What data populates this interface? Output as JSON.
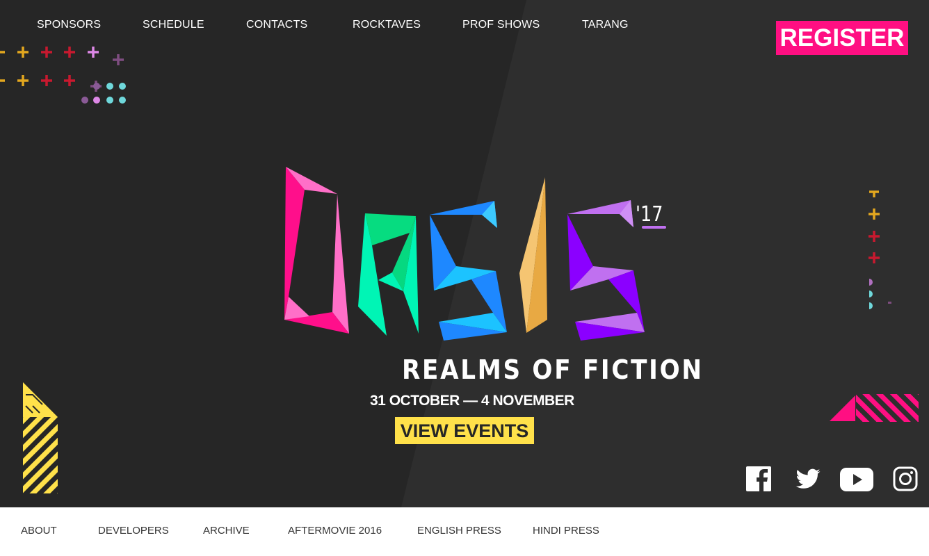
{
  "nav": {
    "items": [
      "SPONSORS",
      "SCHEDULE",
      "CONTACTS",
      "ROCKTAVES",
      "PROF SHOWS",
      "TARANG"
    ],
    "register": "REGISTER"
  },
  "hero": {
    "logo_text": "OASIS",
    "year": "'17",
    "tagline": "REALMS OF FICTION",
    "dates": "31 OCTOBER — 4 NOVEMBER",
    "cta": "VIEW EVENTS"
  },
  "social": [
    "facebook-icon",
    "twitter-icon",
    "youtube-icon",
    "instagram-icon"
  ],
  "footer": {
    "items": [
      "ABOUT",
      "DEVELOPERS",
      "ARCHIVE",
      "AFTERMOVIE 2016",
      "ENGLISH PRESS",
      "HINDI PRESS"
    ]
  },
  "colors": {
    "accent_pink": "#ff0f82",
    "accent_yellow": "#ffe14a",
    "background": "#262626"
  }
}
